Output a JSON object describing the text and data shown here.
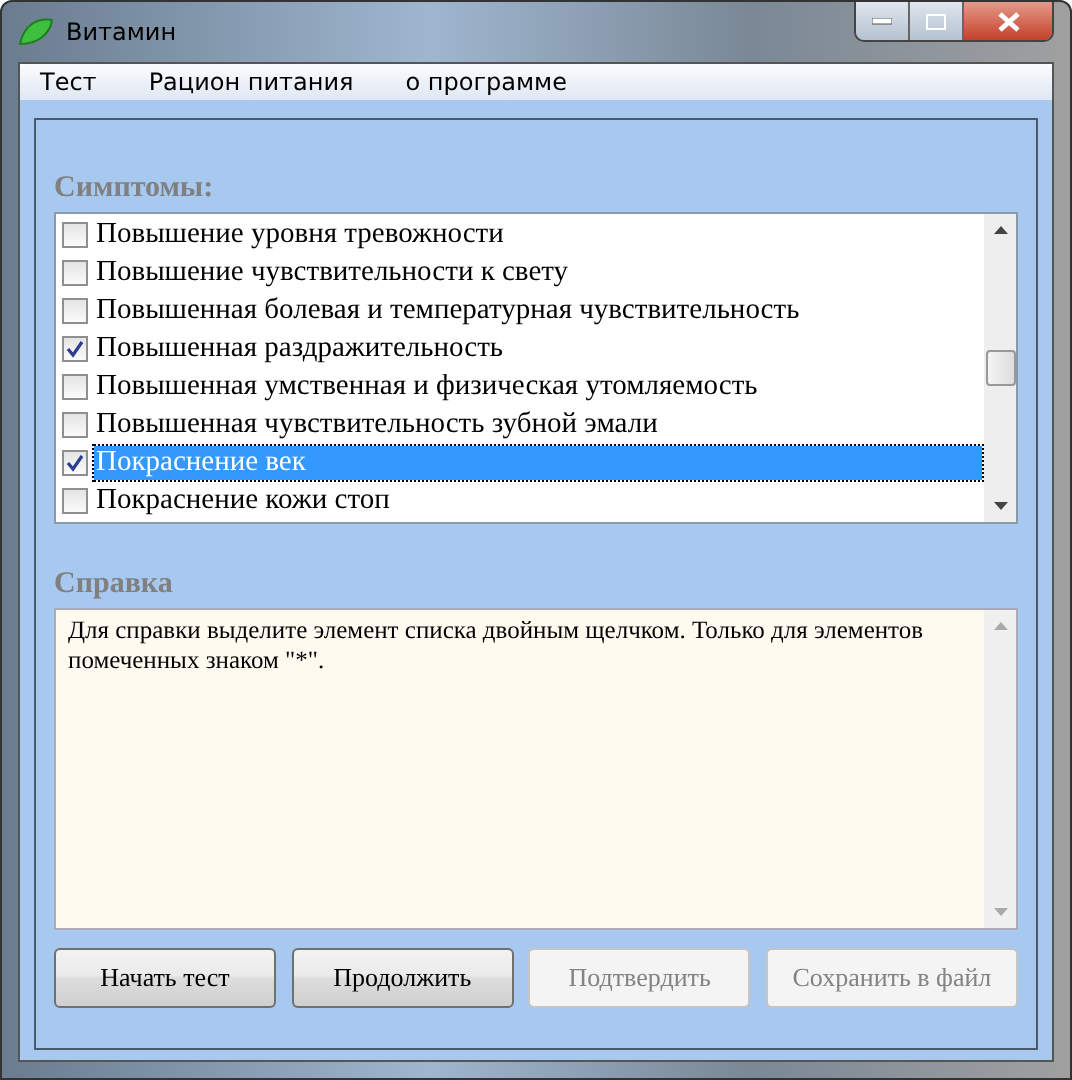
{
  "window": {
    "title": "Витамин"
  },
  "menu": [
    "Тест",
    "Рацион питания",
    "о программе"
  ],
  "symptoms": {
    "label": "Симптомы:",
    "items": [
      {
        "text": "Повышение уровня тревожности",
        "checked": false,
        "selected": false
      },
      {
        "text": "Повышение чувствительности к свету",
        "checked": false,
        "selected": false
      },
      {
        "text": "Повышенная болевая и температурная чувствительность",
        "checked": false,
        "selected": false
      },
      {
        "text": "Повышенная раздражительность",
        "checked": true,
        "selected": false
      },
      {
        "text": "Повышенная умственная и физическая утомляемость",
        "checked": false,
        "selected": false
      },
      {
        "text": "Повышенная чувствительность зубной эмали",
        "checked": false,
        "selected": false
      },
      {
        "text": "Покраснение век",
        "checked": true,
        "selected": true
      },
      {
        "text": "Покраснение кожи стоп",
        "checked": false,
        "selected": false
      }
    ]
  },
  "help": {
    "label": "Справка",
    "text": "Для справки выделите элемент списка двойным щелчком. Только для элементов помеченных знаком \"*\"."
  },
  "buttons": [
    {
      "label": "Начать тест",
      "disabled": false
    },
    {
      "label": "Продолжить",
      "disabled": false
    },
    {
      "label": "Подтвердить",
      "disabled": true
    },
    {
      "label": "Сохранить в файл",
      "disabled": true
    }
  ]
}
